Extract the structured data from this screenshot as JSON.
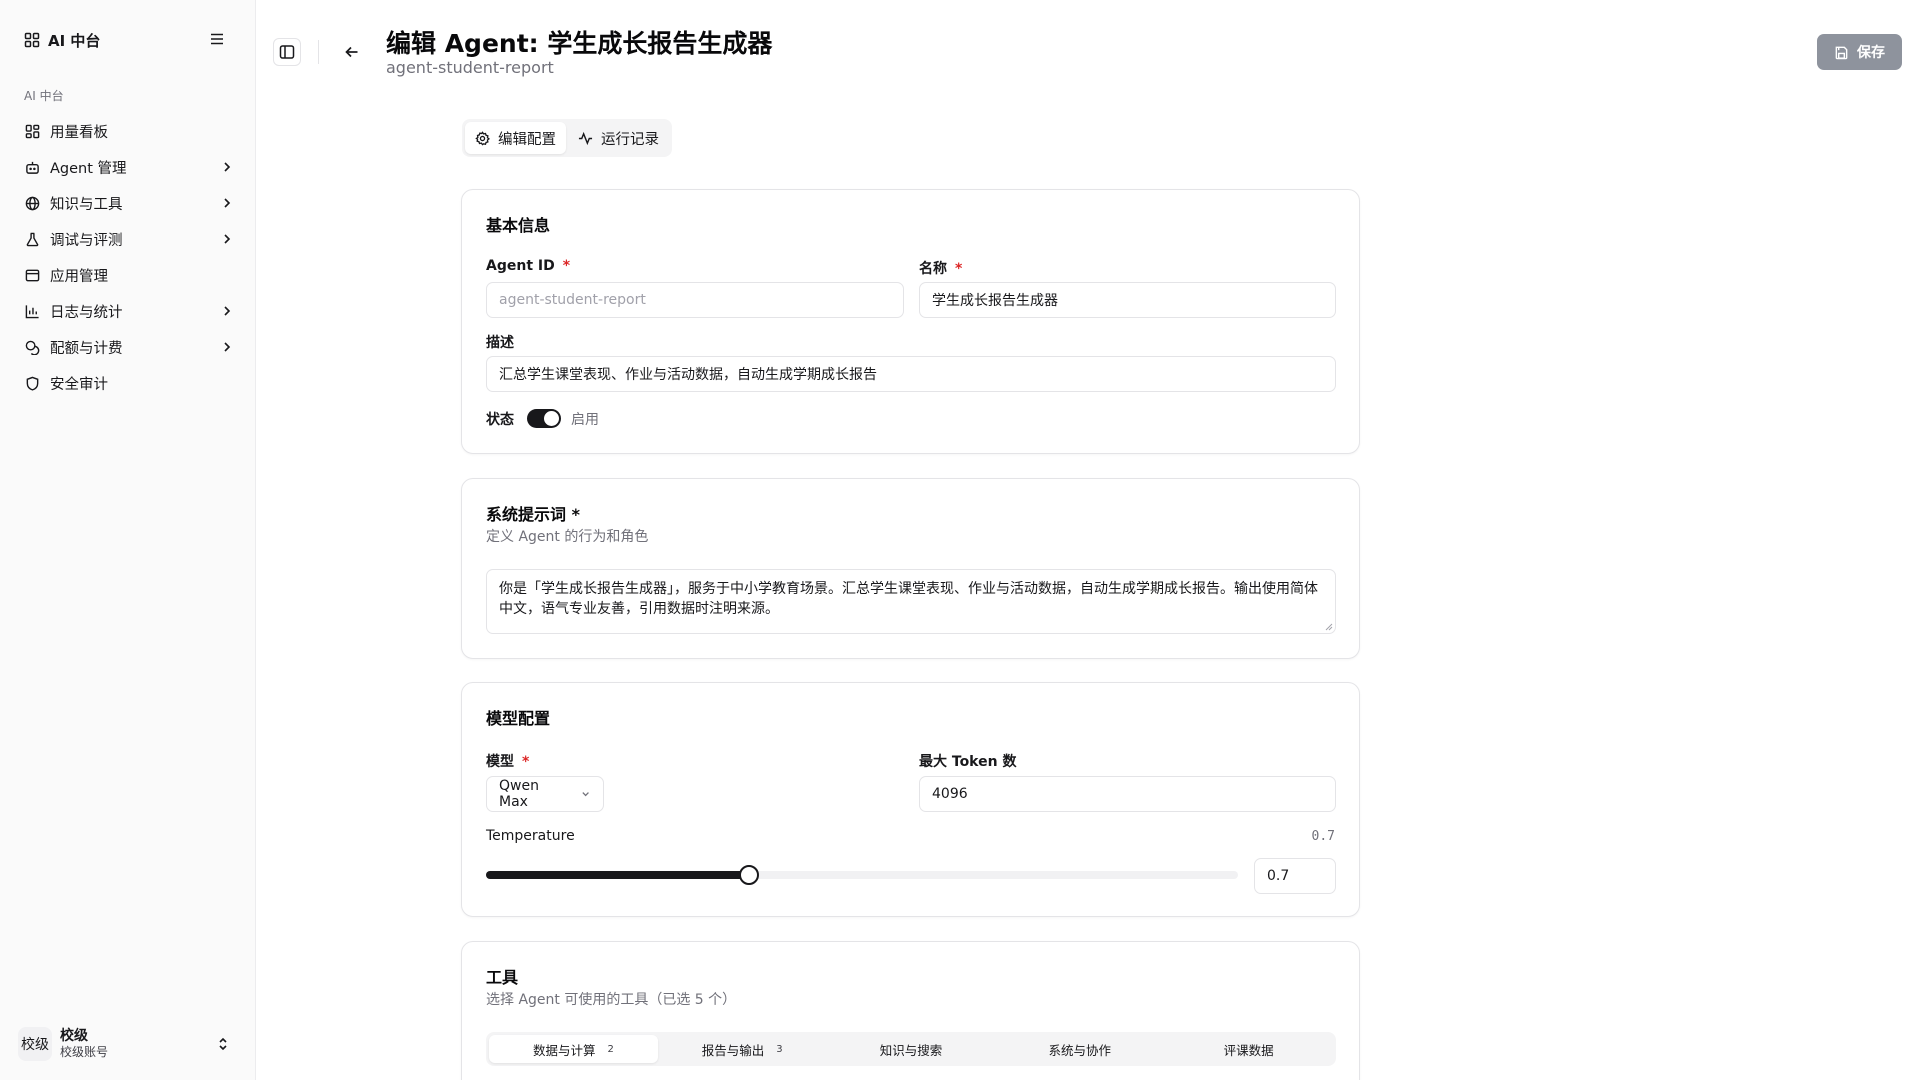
{
  "colors": {
    "accent": "#18181b",
    "required": "#dc2626",
    "save_button_bg": "#8e939d",
    "muted": "#71717a"
  },
  "sidebar": {
    "brand": "AI 中台",
    "group_label": "AI 中台",
    "items": [
      {
        "label": "用量看板",
        "icon": "dashboard-icon",
        "has_chevron": false
      },
      {
        "label": "Agent 管理",
        "icon": "bot-icon",
        "has_chevron": true
      },
      {
        "label": "知识与工具",
        "icon": "globe-icon",
        "has_chevron": true
      },
      {
        "label": "调试与评测",
        "icon": "flask-icon",
        "has_chevron": true
      },
      {
        "label": "应用管理",
        "icon": "app-window-icon",
        "has_chevron": false
      },
      {
        "label": "日志与统计",
        "icon": "bar-chart-icon",
        "has_chevron": true
      },
      {
        "label": "配额与计费",
        "icon": "coins-icon",
        "has_chevron": true
      },
      {
        "label": "安全审计",
        "icon": "shield-icon",
        "has_chevron": false
      }
    ],
    "user": {
      "avatar": "校级",
      "name": "校级",
      "sub": "校级账号"
    }
  },
  "header": {
    "title": "编辑 Agent: 学生成长报告生成器",
    "subtitle": "agent-student-report",
    "save_label": "保存"
  },
  "tabs": [
    {
      "label": "编辑配置",
      "icon": "gear-icon",
      "active": true
    },
    {
      "label": "运行记录",
      "icon": "activity-icon",
      "active": false
    }
  ],
  "basic": {
    "title": "基本信息",
    "agent_id_label": "Agent ID",
    "agent_id_value": "agent-student-report",
    "name_label": "名称",
    "name_value": "学生成长报告生成器",
    "desc_label": "描述",
    "desc_value": "汇总学生课堂表现、作业与活动数据，自动生成学期成长报告",
    "status_label": "状态",
    "status_value": "启用",
    "required_mark": "*"
  },
  "prompt": {
    "title": "系统提示词 *",
    "subtitle": "定义 Agent 的行为和角色",
    "value": "你是「学生成长报告生成器」，服务于中小学教育场景。汇总学生课堂表现、作业与活动数据，自动生成学期成长报告。输出使用简体中文，语气专业友善，引用数据时注明来源。"
  },
  "model": {
    "title": "模型配置",
    "model_label": "模型",
    "model_value": "Qwen Max",
    "max_token_label": "最大 Token 数",
    "max_token_value": "4096",
    "temperature_label": "Temperature",
    "temperature_display": "0.7",
    "temperature_input": "0.7",
    "temperature_value": 0.7,
    "temperature_fraction": 0.35
  },
  "tools": {
    "title": "工具",
    "subtitle": "选择 Agent 可使用的工具（已选 5 个）",
    "categories": [
      {
        "label": "数据与计算",
        "count": "2",
        "active": true
      },
      {
        "label": "报告与输出",
        "count": "3",
        "active": false
      },
      {
        "label": "知识与搜索",
        "count": "",
        "active": false
      },
      {
        "label": "系统与协作",
        "count": "",
        "active": false
      },
      {
        "label": "评课数据",
        "count": "",
        "active": false
      }
    ]
  }
}
